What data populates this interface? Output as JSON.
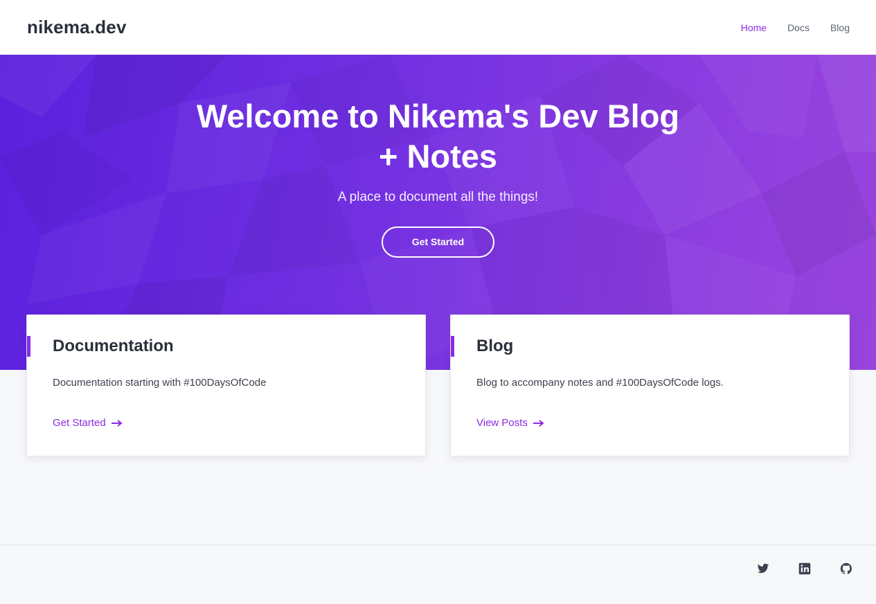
{
  "header": {
    "brand": "nikema.dev",
    "nav": [
      {
        "label": "Home",
        "active": true
      },
      {
        "label": "Docs",
        "active": false
      },
      {
        "label": "Blog",
        "active": false
      }
    ]
  },
  "hero": {
    "title": "Welcome to Nikema's Dev Blog + Notes",
    "tagline": "A place to document all the things!",
    "cta_label": "Get Started"
  },
  "cards": [
    {
      "title": "Documentation",
      "description": "Documentation starting with #100DaysOfCode",
      "link_label": "Get Started",
      "link_icon": "arrow-right-icon"
    },
    {
      "title": "Blog",
      "description": "Blog to accompany notes and #100DaysOfCode logs.",
      "link_label": "View Posts",
      "link_icon": "arrow-right-icon"
    }
  ],
  "footer": {
    "social": [
      {
        "name": "twitter",
        "icon": "twitter-icon"
      },
      {
        "name": "linkedin",
        "icon": "linkedin-icon"
      },
      {
        "name": "github",
        "icon": "github-icon"
      }
    ]
  },
  "colors": {
    "accent": "#8a2be2",
    "hero_start": "#5a20dd",
    "hero_end": "#9844dd",
    "text_dark": "#2b2f3a",
    "background": "#f7f8fa"
  }
}
